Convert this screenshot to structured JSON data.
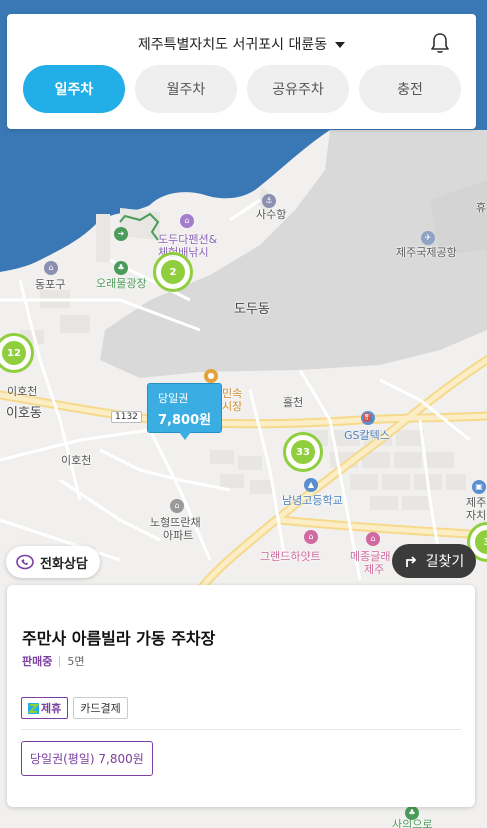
{
  "header": {
    "region": "제주특별자치도 서귀포시 대륜동",
    "tabs": [
      {
        "label": "일주차",
        "active": true
      },
      {
        "label": "월주차",
        "active": false
      },
      {
        "label": "공유주차",
        "active": false
      },
      {
        "label": "충전",
        "active": false
      }
    ]
  },
  "map": {
    "labels": {
      "sasu_port": "사수항",
      "jeju_airport": "제주국제공항",
      "dodu_pension": "도두다펜션&",
      "dodu_pension2": "체험배낚시",
      "dongpogu": "동포구",
      "orae_square": "오래물광장",
      "dodu_dong": "도두동",
      "iho_cheon": "이호천",
      "iho_dong": "이호동",
      "iho_cheon2": "이호천",
      "market": "민속",
      "market2": "시장",
      "heulcheon": "흘천",
      "gs_caltex": "GS칼텍스",
      "namnyeong_high": "남녕고등학교",
      "nohyeong_apt": "노형뜨란채",
      "nohyeong_apt2": "아파트",
      "grand_hyatt": "그랜드하얏트",
      "mezon": "메종글래",
      "mezon2": "제주",
      "jeju_right": "제주",
      "jeju_right2": "자치",
      "road_1132": "1132",
      "hu": "휴",
      "bottom_label": "사의으로"
    },
    "clusters": [
      {
        "count": "2"
      },
      {
        "count": "12"
      },
      {
        "count": "33"
      },
      {
        "count": "3"
      }
    ],
    "price_marker": {
      "type": "당일권",
      "price": "7,800원"
    }
  },
  "buttons": {
    "call": "전화상담",
    "route": "길찾기"
  },
  "lot": {
    "name": "주만사 아름빌라 가동 주차장",
    "status": "판매중",
    "spaces": "5면",
    "tags": [
      "제휴",
      "카드결제"
    ],
    "ticket": "당일권(평일) 7,800원"
  },
  "colors": {
    "accent": "#22aee6",
    "purple": "#7b3fa0",
    "cluster_green": "#8fce3c",
    "sea": "#3a78b5"
  }
}
